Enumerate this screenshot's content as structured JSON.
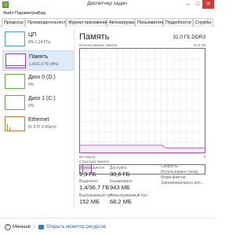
{
  "window": {
    "title": "Диспетчер задач",
    "minimize": "–",
    "maximize": "□",
    "close": "✕"
  },
  "menu": [
    "Файл",
    "Параметры",
    "Вид"
  ],
  "tabs": [
    "Процессы",
    "Производительность",
    "Журнал приложений",
    "Автозагрузка",
    "Пользователи",
    "Подробности",
    "Службы"
  ],
  "sidebar": {
    "items": [
      {
        "name": "ЦП",
        "value": "0% 1,14 ГГц",
        "color": "#4aa0d5"
      },
      {
        "name": "Память",
        "value": "1,4/31,9 ГБ (4%)",
        "color": "#a74ab0"
      },
      {
        "name": "Диск 0 (D:)",
        "value": "0%",
        "color": "#62b04a"
      },
      {
        "name": "Диск 1 (C:)",
        "value": "0%",
        "color": "#62b04a"
      },
      {
        "name": "Ethernet",
        "value": "О: 0 П: 0 Кбит/с",
        "color": "#c97d3a"
      }
    ]
  },
  "main": {
    "title": "Память",
    "spec": "32,0 ГБ DDR3",
    "usage_label": "Использование памяти",
    "usage_max": "31,9 ГБ",
    "time_label": "60 секунд",
    "zero_label": "0",
    "struct_label": "Структура памяти",
    "accent": "#a74ab0",
    "graph_series": [
      2.2,
      2.2,
      2.2,
      2.2,
      2.2,
      2.2,
      2.2,
      2.2,
      2.2,
      2.2,
      2.2,
      2.2,
      2.2,
      2.2,
      2.2,
      2.2,
      2.2,
      2.2,
      2.2,
      2.2,
      2.2,
      2.2,
      2.2,
      2.2,
      2.2,
      2.2,
      2.2,
      2.2,
      2.2,
      2.2,
      2.2,
      2.2,
      2.2,
      2.2,
      2.2,
      2.2,
      2.2,
      2.2,
      2.2,
      2.2,
      1.6,
      1.4,
      1.4,
      1.4,
      1.4,
      1.4,
      1.4,
      1.4,
      1.4,
      1.4,
      1.4,
      1.4,
      1.4,
      1.4,
      1.4,
      1.4,
      1.4,
      1.4,
      1.4,
      1.4
    ]
  },
  "stats": {
    "in_use_label": "Используется",
    "in_use": "1,3 ГБ",
    "available_label": "Доступно",
    "available": "30,6 ГБ",
    "committed_label": "Выделено",
    "committed": "1,4/36,7 ГБ",
    "cached_label": "Кэшировано",
    "cached": "943 МБ",
    "paged_label": "Выгружаемый пул",
    "paged": "152 МБ",
    "nonpaged_label": "Невыгружаемый пул",
    "nonpaged": "68,2 МБ"
  },
  "props": {
    "speed_label": "Скорость:",
    "speed": "",
    "slots_label": "Использовано гнезд:",
    "slots": "",
    "form_label": "Форм-фактор:",
    "form": "",
    "reserved_label": "Зарезервировано апп...",
    "reserved": ""
  },
  "footer": {
    "less": "Меньше",
    "separator": "|",
    "monitor": "Открыть монитор ресурсов"
  }
}
